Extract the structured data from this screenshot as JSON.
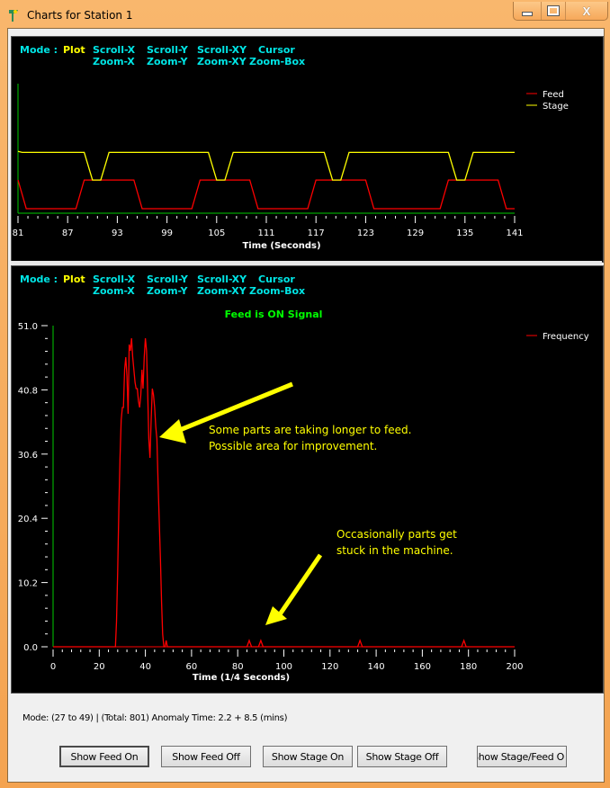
{
  "window": {
    "title": "Charts for Station 1",
    "controls": {
      "minimize": "minimize-icon",
      "maximize": "maximize-icon",
      "close": "close-icon"
    }
  },
  "modebar": {
    "label": "Mode :",
    "active": "Plot",
    "row1": [
      "Scroll-X",
      "Scroll-Y",
      "Scroll-XY",
      "Cursor"
    ],
    "row2": [
      "Zoom-X",
      "Zoom-Y",
      "Zoom-XY",
      "Zoom-Box"
    ]
  },
  "colors": {
    "background": "#000000",
    "axis": "#00cc00",
    "feed": "#ff0000",
    "stage": "#ffff00",
    "modebar_text": "#00e5e5",
    "annotation": "#ffff00",
    "signal_title": "#00ff00"
  },
  "chart_data": [
    {
      "type": "line",
      "title": "",
      "xlabel": "Time (Seconds)",
      "ylabel": "",
      "xlim": [
        81,
        141
      ],
      "ylim": [
        0,
        1.3
      ],
      "x_ticks": [
        81,
        87,
        93,
        99,
        105,
        111,
        117,
        123,
        129,
        135,
        141
      ],
      "legend": {
        "position": "top-right",
        "entries": [
          "Feed",
          "Stage"
        ]
      },
      "grid": false,
      "series": [
        {
          "name": "Feed",
          "color": "#ff0000",
          "x": [
            81,
            82,
            88,
            89,
            95,
            96,
            102,
            103,
            109,
            110,
            116,
            117,
            123,
            124,
            132,
            133,
            139,
            140,
            141
          ],
          "y": [
            0.5,
            0,
            0,
            0.5,
            0.5,
            0,
            0,
            0.5,
            0.5,
            0,
            0,
            0.5,
            0.5,
            0,
            0,
            0.5,
            0.5,
            0,
            0
          ]
        },
        {
          "name": "Stage",
          "color": "#ffff00",
          "x": [
            81,
            81.5,
            89,
            90,
            91,
            92,
            104,
            105,
            106,
            107,
            118,
            119,
            120,
            121,
            133,
            134,
            135,
            136,
            141
          ],
          "y": [
            1.0,
            0.98,
            0.98,
            0.5,
            0.5,
            0.98,
            0.98,
            0.5,
            0.5,
            0.98,
            0.98,
            0.5,
            0.5,
            0.98,
            0.98,
            0.5,
            0.5,
            0.98,
            0.98
          ]
        }
      ]
    },
    {
      "type": "line",
      "title": "Feed is ON Signal",
      "xlabel": "Time (1/4 Seconds)",
      "ylabel": "",
      "xlim": [
        0,
        200
      ],
      "ylim": [
        0.0,
        51.0
      ],
      "x_ticks": [
        0,
        20,
        40,
        60,
        80,
        100,
        120,
        140,
        160,
        180,
        200
      ],
      "y_ticks": [
        0.0,
        10.2,
        20.4,
        30.6,
        40.8,
        51.0
      ],
      "legend": {
        "position": "top-right",
        "entries": [
          "Frequency"
        ]
      },
      "grid": false,
      "series": [
        {
          "name": "Frequency",
          "color": "#ff0000",
          "x": [
            0,
            27,
            27.5,
            28,
            28.5,
            29,
            29.5,
            30,
            30.5,
            31,
            31.5,
            32,
            32.5,
            33,
            33.5,
            34,
            34.5,
            35,
            35.5,
            36,
            36.5,
            37,
            37.5,
            38,
            38.5,
            39,
            39.5,
            40,
            40.5,
            41,
            41.5,
            42,
            42.5,
            43,
            43.5,
            44,
            44.5,
            45,
            45.5,
            46,
            46.5,
            47,
            47.5,
            48,
            48.5,
            49,
            49.5,
            50,
            50.5,
            51,
            84,
            85,
            86,
            89,
            90,
            91,
            132,
            133,
            134,
            177,
            178,
            179,
            200
          ],
          "y": [
            0,
            0,
            4,
            12,
            22,
            30,
            36,
            38,
            38,
            44,
            46,
            43,
            37,
            48,
            47,
            49,
            46,
            44,
            42,
            41,
            41,
            39,
            38,
            40,
            44,
            41,
            46,
            49,
            47,
            40,
            33,
            30,
            36,
            41,
            40,
            38,
            35,
            33,
            26,
            20,
            14,
            7,
            2,
            0,
            0,
            1,
            0,
            0,
            0,
            0,
            0,
            1,
            0,
            0,
            1,
            0,
            0,
            1,
            0,
            0,
            1,
            0,
            0
          ]
        }
      ],
      "annotations": [
        {
          "text_lines": [
            "Some parts are taking longer to feed.",
            "Possible area for improvement."
          ],
          "arrow_target_x": 46,
          "arrow_target_y": 33
        },
        {
          "text_lines": [
            "Occasionally parts get",
            "stuck in the machine."
          ],
          "arrow_target_x": 92,
          "arrow_target_y": 3
        }
      ]
    }
  ],
  "status": {
    "text": "Mode: (27 to 49) |   (Total: 801)   Anomaly Time: 2.2 + 8.5 (mins)"
  },
  "buttons": [
    {
      "label": "Show Feed On"
    },
    {
      "label": "Show Feed Off"
    },
    {
      "label": "Show Stage On"
    },
    {
      "label": "Show Stage Off"
    },
    {
      "label": "Show Stage/Feed O"
    }
  ]
}
